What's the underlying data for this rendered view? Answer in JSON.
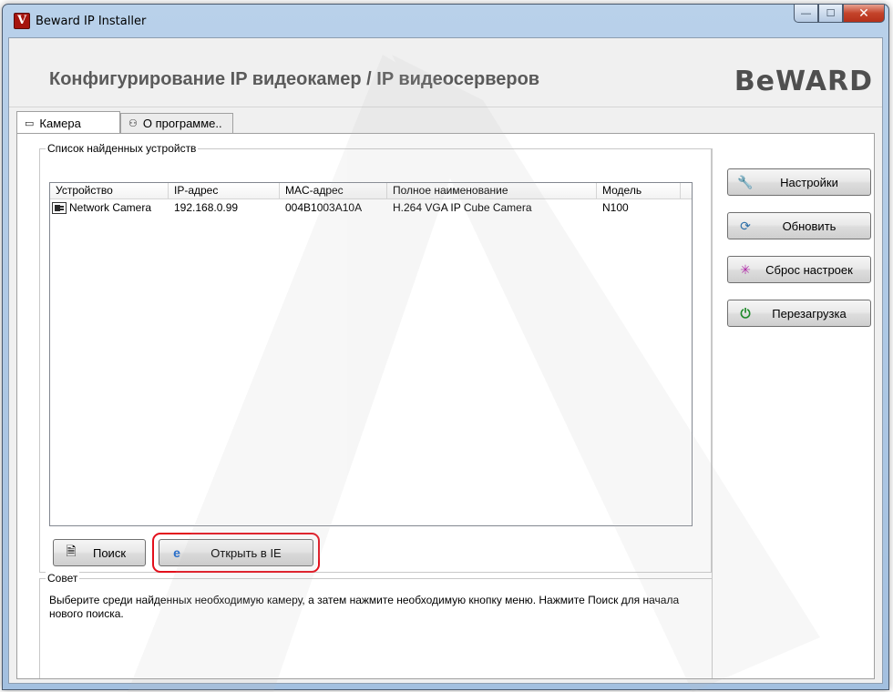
{
  "window": {
    "title": "Beward IP Installer",
    "controls": {
      "minimize": "—",
      "maximize": "☐",
      "close": "✕"
    }
  },
  "header": {
    "title": "Конфигурирование IP видеокамер / IP видеосерверов",
    "brand": "BeWARD"
  },
  "tabs": [
    {
      "label": "Камера",
      "active": true
    },
    {
      "label": "О программе..",
      "active": false
    }
  ],
  "devices_group": {
    "legend": "Список найденных устройств",
    "columns": [
      "Устройство",
      "IP-адрес",
      "MAC-адрес",
      "Полное наименование",
      "Модель"
    ],
    "rows": [
      [
        "Network Camera",
        "192.168.0.99",
        "004B1003A10A",
        "H.264 VGA IP Cube Camera",
        "N100"
      ]
    ]
  },
  "buttons": {
    "search": "Поиск",
    "open_ie": "Открыть в IE",
    "settings": "Настройки",
    "refresh": "Обновить",
    "reset": "Сброс настроек",
    "reboot": "Перезагрузка"
  },
  "tip": {
    "legend": "Совет",
    "text": "Выберите среди найденных необходимую камеру, а затем нажмите необходимую кнопку меню. Нажмите Поиск для начала нового поиска."
  },
  "colors": {
    "highlight": "#e3101c",
    "title_bar": "#b9d1ea"
  }
}
